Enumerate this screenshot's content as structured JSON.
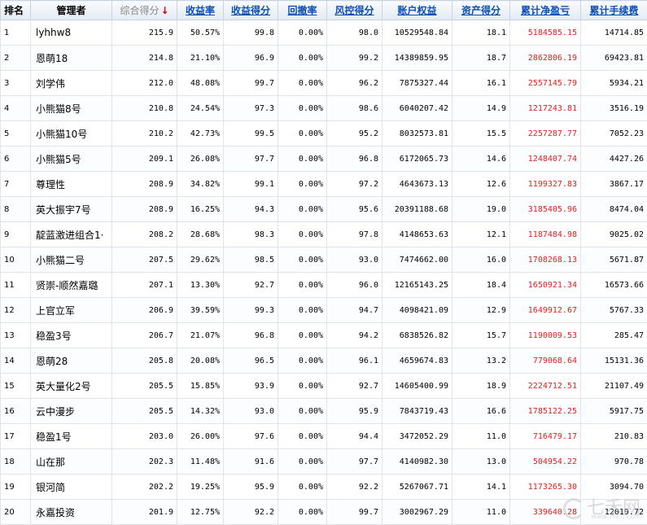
{
  "headers": [
    "排名",
    "管理者",
    "综合得分",
    "收益率",
    "收益得分",
    "回撤率",
    "风控得分",
    "账户权益",
    "资产得分",
    "累计净盈亏",
    "累计手续费"
  ],
  "sort_arrow": "↓",
  "colors": {
    "profit": "#e0201e",
    "link_header": "#0a4fb5"
  },
  "rows": [
    [
      "1",
      "lyhhw8",
      "215.9",
      "50.57%",
      "99.8",
      "0.00%",
      "98.0",
      "10529548.84",
      "18.1",
      "5184585.15",
      "14714.85"
    ],
    [
      "2",
      "恩萌18",
      "214.8",
      "21.10%",
      "96.9",
      "0.00%",
      "99.2",
      "14389859.95",
      "18.7",
      "2862806.19",
      "69423.81"
    ],
    [
      "3",
      "刘学伟",
      "212.0",
      "48.08%",
      "99.7",
      "0.00%",
      "96.2",
      "7875327.44",
      "16.1",
      "2557145.79",
      "5934.21"
    ],
    [
      "4",
      "小熊猫8号",
      "210.8",
      "24.54%",
      "97.3",
      "0.00%",
      "98.6",
      "6040207.42",
      "14.9",
      "1217243.81",
      "3516.19"
    ],
    [
      "5",
      "小熊猫10号",
      "210.2",
      "42.73%",
      "99.5",
      "0.00%",
      "95.2",
      "8032573.81",
      "15.5",
      "2257287.77",
      "7052.23"
    ],
    [
      "6",
      "小熊猫5号",
      "209.1",
      "26.08%",
      "97.7",
      "0.00%",
      "96.8",
      "6172065.73",
      "14.6",
      "1248407.74",
      "4427.26"
    ],
    [
      "7",
      "尊理性",
      "208.9",
      "34.82%",
      "99.1",
      "0.00%",
      "97.2",
      "4643673.13",
      "12.6",
      "1199327.83",
      "3867.17"
    ],
    [
      "8",
      "英大振宇7号",
      "208.9",
      "16.25%",
      "94.3",
      "0.00%",
      "95.6",
      "20391188.68",
      "19.0",
      "3185405.96",
      "8474.04"
    ],
    [
      "9",
      "靛蓝激进组合1·",
      "208.2",
      "28.68%",
      "98.3",
      "0.00%",
      "97.8",
      "4148653.63",
      "12.1",
      "1187484.98",
      "9025.02"
    ],
    [
      "10",
      "小熊猫二号",
      "207.5",
      "29.62%",
      "98.5",
      "0.00%",
      "93.0",
      "7474662.00",
      "16.0",
      "1708268.13",
      "5671.87"
    ],
    [
      "11",
      "贤崇-顺然嘉璐",
      "207.1",
      "13.30%",
      "92.7",
      "0.00%",
      "96.0",
      "12165143.25",
      "18.4",
      "1650921.34",
      "16573.66"
    ],
    [
      "12",
      "上官立军",
      "206.9",
      "39.59%",
      "99.3",
      "0.00%",
      "94.7",
      "4098421.09",
      "12.9",
      "1649912.67",
      "5767.33"
    ],
    [
      "13",
      "稳盈3号",
      "206.7",
      "21.07%",
      "96.8",
      "0.00%",
      "94.2",
      "6838526.82",
      "15.7",
      "1190009.53",
      "285.47"
    ],
    [
      "14",
      "恩萌28",
      "205.8",
      "20.08%",
      "96.5",
      "0.00%",
      "96.1",
      "4659674.83",
      "13.2",
      "779068.64",
      "15131.36"
    ],
    [
      "15",
      "英大量化2号",
      "205.5",
      "15.85%",
      "93.9",
      "0.00%",
      "92.7",
      "14605400.99",
      "18.9",
      "2224712.51",
      "21107.49"
    ],
    [
      "16",
      "云中漫步",
      "205.5",
      "14.32%",
      "93.0",
      "0.00%",
      "95.9",
      "7843719.43",
      "16.6",
      "1785122.25",
      "5917.75"
    ],
    [
      "17",
      "稳盈1号",
      "203.0",
      "26.00%",
      "97.6",
      "0.00%",
      "94.4",
      "3472052.29",
      "11.0",
      "716479.17",
      "210.83"
    ],
    [
      "18",
      "山在那",
      "202.3",
      "11.48%",
      "91.6",
      "0.00%",
      "97.7",
      "4140982.30",
      "13.0",
      "504954.22",
      "970.78"
    ],
    [
      "19",
      "银河简",
      "202.2",
      "19.25%",
      "95.9",
      "0.00%",
      "92.2",
      "5267067.71",
      "14.1",
      "1173265.30",
      "3094.70"
    ],
    [
      "20",
      "永嘉投资",
      "201.9",
      "12.75%",
      "92.2",
      "0.00%",
      "99.7",
      "3002967.29",
      "11.0",
      "339640.28",
      "12019.72"
    ]
  ],
  "watermark": {
    "text": "七禾网",
    "url": "www.7hcn.com"
  }
}
